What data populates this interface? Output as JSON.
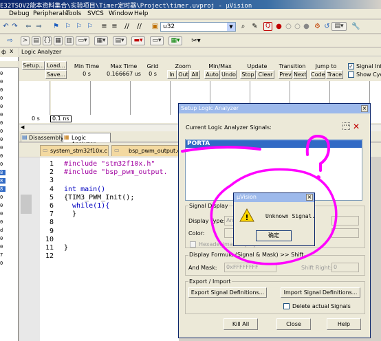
{
  "title_bar": {
    "text": "E32TSOV2能本资料集合\\实验项目\\Timer定时器\\Project\\timer.uvproj - µVision"
  },
  "menu": {
    "items": [
      "Debug",
      "Peripherals",
      "Tools",
      "SVCS",
      "Window",
      "Help"
    ],
    "mnemonics": [
      "D",
      "p",
      "T",
      "S",
      "W",
      "H"
    ]
  },
  "toolbar": {
    "target_combo": "u32"
  },
  "left_panel": {
    "close_glyph": "x",
    "pin_glyph": "ф",
    "numbers": [
      "0",
      "0",
      "0",
      "0",
      "0",
      "0",
      "0",
      "0",
      "0",
      "0",
      "0",
      "0",
      "8",
      "8",
      "8",
      "0",
      "0",
      "0",
      "0",
      "d",
      "0",
      "0",
      "7",
      "0"
    ]
  },
  "logic_analyzer": {
    "title": "Logic Analyzer",
    "setup_button": "Setup...",
    "load_button": "Load...",
    "save_button": "Save...",
    "min_time_label": "Min Time",
    "min_time_value": "0 s",
    "max_time_label": "Max Time",
    "max_time_value": "0.166667 us",
    "grid_label": "Grid",
    "grid_value": "0 s",
    "zoom_label": "Zoom",
    "zoom_in": "In",
    "zoom_out": "Out",
    "zoom_all": "All",
    "minmax_label": "Min/Max",
    "auto_button": "Auto",
    "undo_button": "Undo",
    "update_label": "Update Screen",
    "stop_button": "Stop",
    "clear_button": "Clear",
    "transition_label": "Transition",
    "prev_button": "Prev",
    "next_button": "Next",
    "jumpto_label": "Jump to",
    "code_button": "Code",
    "trace_button": "Trace",
    "signal_info_label": "Signal Info",
    "show_cycles_label": "Show Cycles",
    "time_start": "0 s",
    "time_cursor": "0.1 ns"
  },
  "tabs": {
    "disassembly": "Disassembly",
    "logic_analyzer": "Logic Analyzer"
  },
  "editor": {
    "file_tabs": [
      "system_stm32f10x.c",
      "bsp_pwm_output.c"
    ],
    "lines": [
      {
        "num": "1",
        "text": "#include \"stm32f10x.h\""
      },
      {
        "num": "2",
        "text": "#include \"bsp_pwm_output."
      },
      {
        "num": "3",
        "text": ""
      },
      {
        "num": "4",
        "text": "int main()"
      },
      {
        "num": "5",
        "text": "{TIM3_PWM_Init();"
      },
      {
        "num": "6",
        "text": "  while(1){"
      },
      {
        "num": "7",
        "text": "  }"
      },
      {
        "num": "8",
        "text": ""
      },
      {
        "num": "9",
        "text": ""
      },
      {
        "num": "10",
        "text": ""
      },
      {
        "num": "11",
        "text": "}"
      },
      {
        "num": "12",
        "text": ""
      }
    ]
  },
  "setup_dialog": {
    "title": "Setup Logic Analyzer",
    "current_signals_label": "Current Logic Analyzer Signals:",
    "selected_signal": "PORTA",
    "signal_display_label": "Signal Display",
    "display_type_label": "Display Type:",
    "display_type_value": "An",
    "color_label": "Color:",
    "hexadecimal_label": "Hexadecimal Display",
    "formula_label": "Display Formula (Signal & Mask) >> Shift",
    "and_mask_label": "And Mask:",
    "and_mask_value": "0xFFFFFFFF",
    "shift_right_label": "Shift Right:",
    "shift_right_value": "0",
    "export_import_label": "Export / Import",
    "export_button": "Export Signal Definitions...",
    "import_button": "Import Signal Definitions...",
    "delete_signals_label": "Delete actual Signals",
    "kill_all_button": "Kill All",
    "close_button": "Close",
    "help_button": "Help"
  },
  "message_box": {
    "title": "µVision",
    "message": "Unknown Signal.",
    "ok_button": "确定"
  },
  "annotation_color": "#ff00ff"
}
